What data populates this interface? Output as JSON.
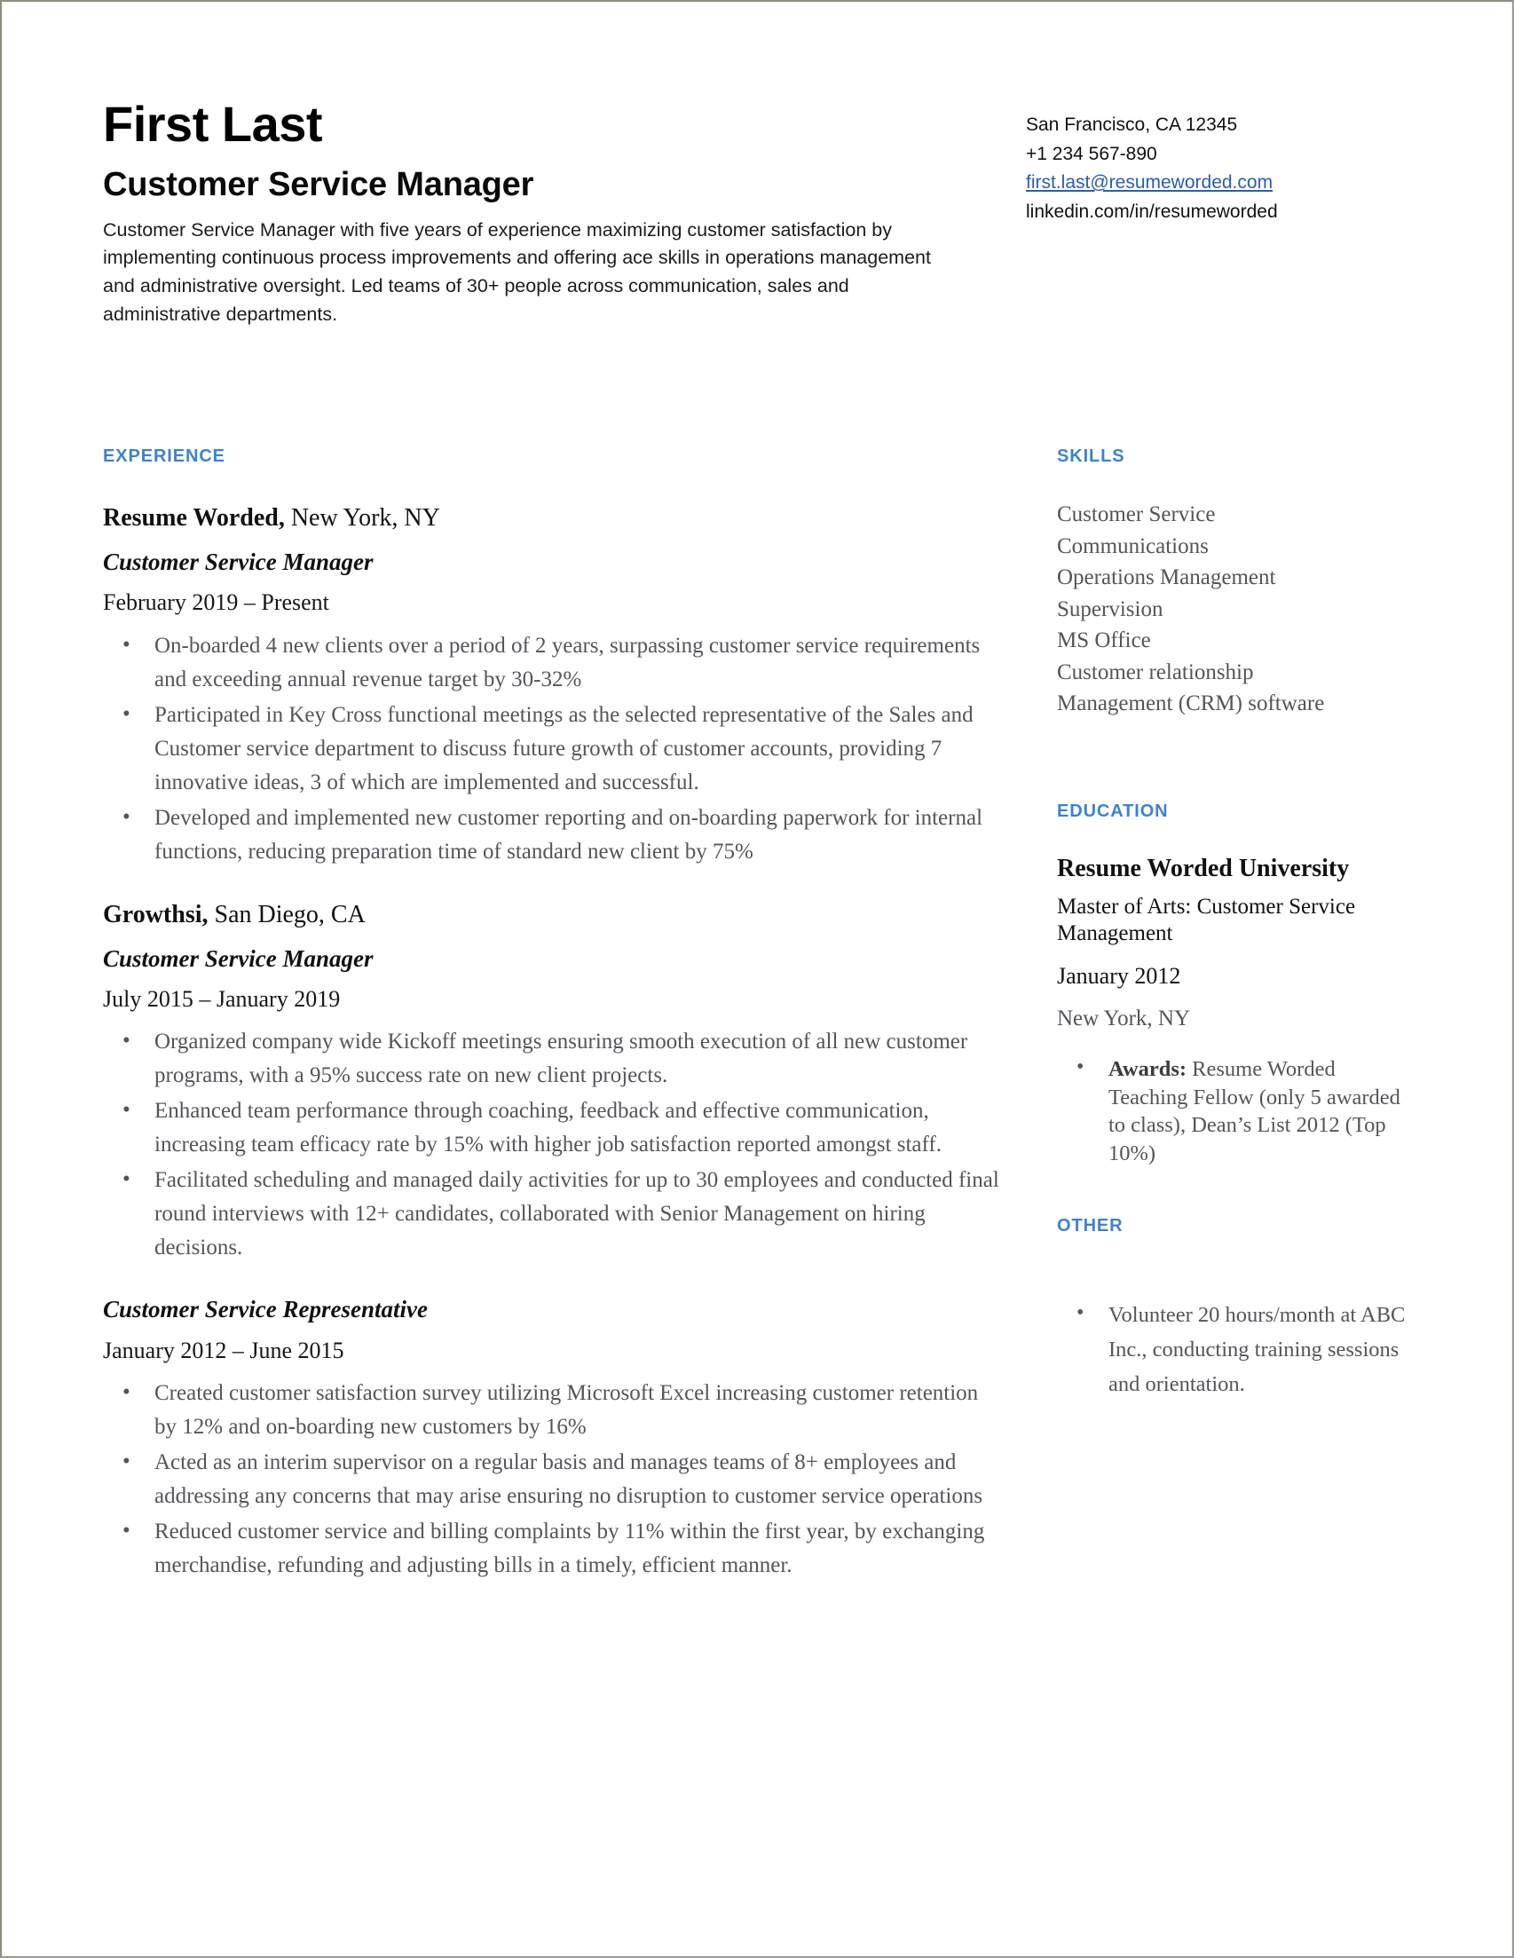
{
  "header": {
    "name": "First Last",
    "title": "Customer Service Manager",
    "summary": "Customer Service Manager with five years of experience maximizing customer satisfaction by implementing continuous process improvements and offering ace skills in operations management and administrative oversight. Led teams of 30+ people across communication, sales and administrative departments.",
    "contact": {
      "location": "San Francisco, CA 12345",
      "phone": "+1 234 567-890",
      "email": "first.last@resumeworded.com",
      "linkedin": "linkedin.com/in/resumeworded"
    }
  },
  "sections": {
    "experience_label": "EXPERIENCE",
    "skills_label": "SKILLS",
    "education_label": "EDUCATION",
    "other_label": "OTHER"
  },
  "experience": [
    {
      "company": "Resume Worded,",
      "location": " New York, NY",
      "role": "Customer Service Manager",
      "dates": "February 2019 – Present",
      "bullets": [
        "On-boarded 4 new clients over a period of 2 years, surpassing customer service requirements and exceeding annual revenue target by 30-32%",
        "Participated in Key Cross functional meetings as the selected representative of the Sales and Customer service department to discuss future growth of customer accounts, providing 7 innovative  ideas, 3 of which are implemented and successful.",
        "Developed and implemented new customer reporting and on-boarding paperwork for internal functions, reducing preparation time of standard new client by 75%"
      ]
    },
    {
      "company": "Growthsi,",
      "location": " San Diego, CA",
      "role": "Customer Service Manager",
      "dates": "July 2015 – January 2019",
      "bullets": [
        "Organized company wide Kickoff meetings ensuring smooth execution of all new customer programs, with a 95% success rate on new client projects.",
        "Enhanced team performance through coaching, feedback and effective communication, increasing team efficacy rate by 15% with higher job satisfaction reported amongst staff.",
        "Facilitated scheduling and managed daily activities for up to 30 employees and conducted final round interviews with 12+ candidates, collaborated with Senior Management on hiring decisions."
      ]
    }
  ],
  "experience_extra_role": {
    "role": "Customer Service Representative",
    "dates": "January 2012 – June 2015",
    "bullets": [
      "Created customer satisfaction survey utilizing Microsoft Excel increasing customer retention by 12% and on-boarding new customers by 16%",
      "Acted as an interim supervisor on a regular basis and manages teams of 8+ employees and addressing any concerns that may arise ensuring no disruption to customer service operations",
      "Reduced customer service and billing complaints by 11% within the first year, by exchanging merchandise, refunding and adjusting bills in a timely, efficient manner."
    ]
  },
  "skills": [
    "Customer Service",
    "Communications",
    "Operations Management",
    "Supervision",
    "MS Office",
    "Customer relationship",
    "Management (CRM) software"
  ],
  "education": {
    "school": "Resume Worded University",
    "degree": "Master of Arts: Customer Service Management",
    "date": "January 2012",
    "location": "New York, NY",
    "award_label": "Awards:",
    "award_text": " Resume Worded Teaching Fellow (only 5 awarded to class), Dean’s List 2012 (Top 10%)"
  },
  "other": [
    "Volunteer 20 hours/month at ABC Inc., conducting training sessions and orientation."
  ],
  "colors": {
    "accent": "#3d82d2",
    "link": "#2a5db0",
    "body_text": "#53555a"
  }
}
